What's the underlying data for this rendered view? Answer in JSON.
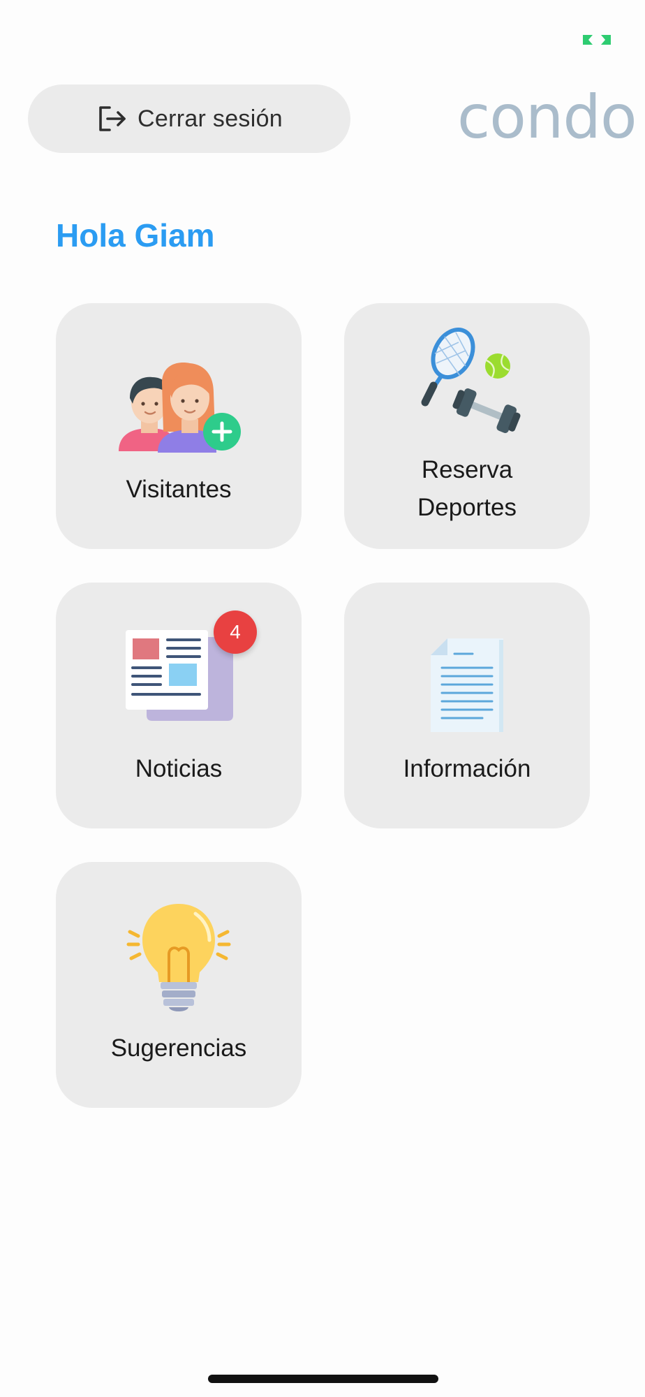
{
  "header": {
    "logout_label": "Cerrar sesión",
    "logout_icon": "logout-icon",
    "brand": "condo",
    "brand_color": "#aabccb"
  },
  "greeting": {
    "text": "Hola Giam",
    "color": "#2b9cf2"
  },
  "tiles": [
    {
      "label": "Visitantes",
      "icon": "visitors-icon"
    },
    {
      "label_line1": "Reserva",
      "label_line2": "Deportes",
      "icon": "sports-icon"
    },
    {
      "label": "Noticias",
      "icon": "newspaper-icon",
      "badge": "4",
      "badge_color": "#e84141"
    },
    {
      "label": "Información",
      "icon": "document-icon"
    },
    {
      "label": "Sugerencias",
      "icon": "lightbulb-icon"
    }
  ],
  "status": {
    "indicator_color": "#2ecc71"
  }
}
